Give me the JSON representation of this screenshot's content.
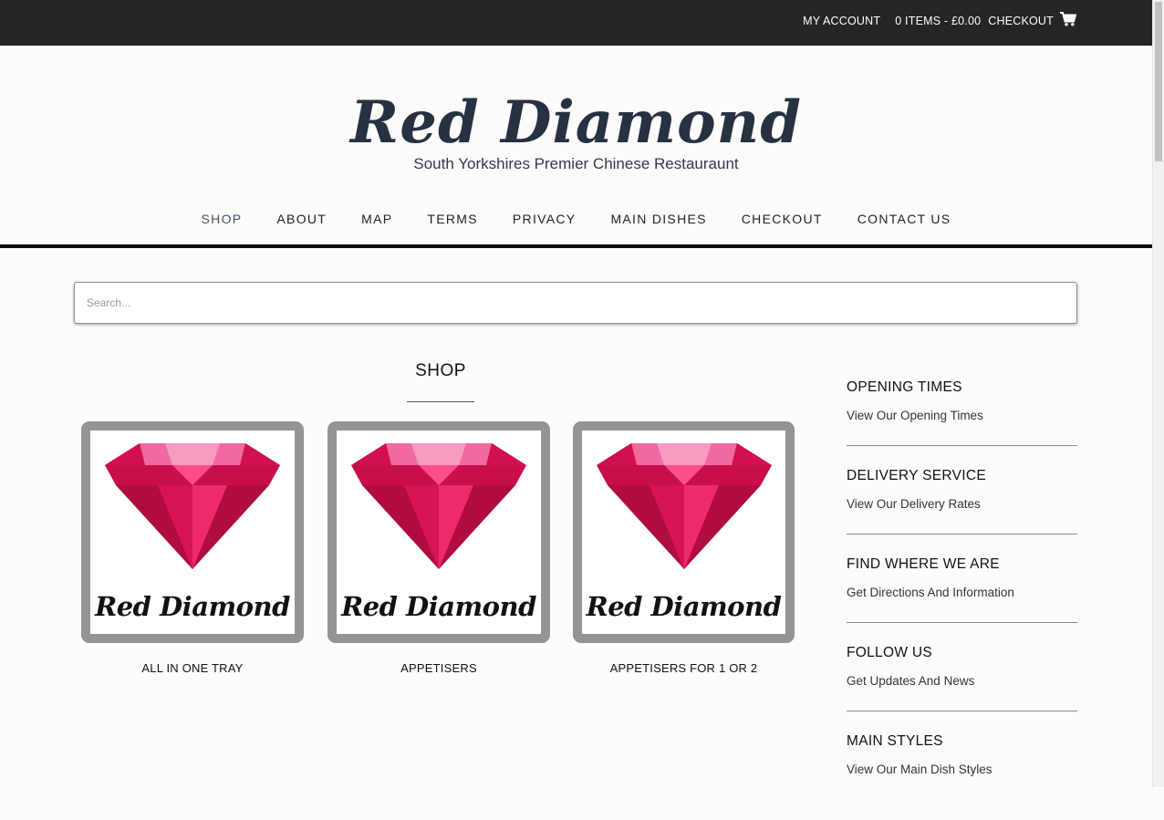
{
  "topbar": {
    "my_account": "MY ACCOUNT",
    "cart_summary": "0 ITEMS - £0.00",
    "checkout": "CHECKOUT",
    "cart_icon": "shopping-cart-icon"
  },
  "header": {
    "brand": "Red Diamond",
    "tagline": "South Yorkshires Premier Chinese Restauraunt"
  },
  "nav": {
    "items": [
      "SHOP",
      "ABOUT",
      "MAP",
      "TERMS",
      "PRIVACY",
      "MAIN DISHES",
      "CHECKOUT",
      "CONTACT US"
    ],
    "active": "SHOP"
  },
  "search": {
    "placeholder": "Search...",
    "value": ""
  },
  "main": {
    "title": "SHOP",
    "products": [
      {
        "image_text": "Red Diamond",
        "caption": "ALL IN ONE TRAY"
      },
      {
        "image_text": "Red Diamond",
        "caption": "APPETISERS"
      },
      {
        "image_text": "Red Diamond",
        "caption": "APPETISERS FOR 1 OR 2"
      }
    ]
  },
  "sidebar": {
    "widgets": [
      {
        "title": "OPENING TIMES",
        "link": "View Our Opening Times"
      },
      {
        "title": "DELIVERY SERVICE",
        "link": "View Our Delivery Rates"
      },
      {
        "title": "FIND WHERE WE ARE",
        "link": "Get Directions And Information"
      },
      {
        "title": "FOLLOW US",
        "link": "Get Updates And News"
      },
      {
        "title": "MAIN STYLES",
        "link": "View Our Main Dish Styles"
      }
    ]
  },
  "colors": {
    "topbar": "#252525",
    "brand": "#263142",
    "diamond": "#e8175d",
    "frame": "#949494"
  }
}
